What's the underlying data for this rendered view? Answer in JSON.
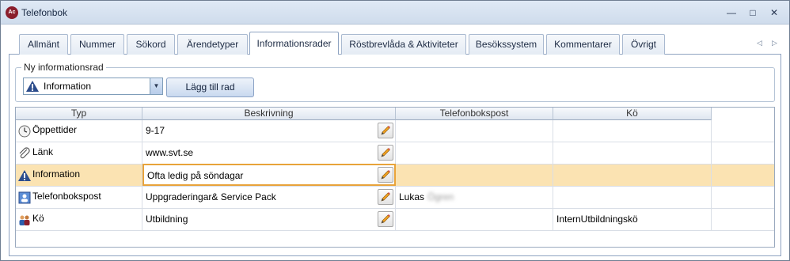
{
  "window": {
    "title": "Telefonbok",
    "app_icon": "Ac",
    "controls": [
      "—",
      "□",
      "✕"
    ]
  },
  "tabs": [
    {
      "label": "Allmänt"
    },
    {
      "label": "Nummer"
    },
    {
      "label": "Sökord"
    },
    {
      "label": "Ärendetyper"
    },
    {
      "label": "Informationsrader",
      "active": true
    },
    {
      "label": "Röstbrevlåda & Aktiviteter"
    },
    {
      "label": "Besökssystem"
    },
    {
      "label": "Kommentarer"
    },
    {
      "label": "Övrigt"
    }
  ],
  "tab_scroll": {
    "left": "◁",
    "right": "▷"
  },
  "new_row": {
    "legend": "Ny informationsrad",
    "type_value": "Information",
    "dropdown_arrow": "▼",
    "add_label": "Lägg till rad"
  },
  "grid": {
    "columns": [
      "Typ",
      "Beskrivning",
      "Telefonbokspost",
      "Kö"
    ],
    "rows": [
      {
        "icon": "clock-icon",
        "type": "Öppettider",
        "description": "9-17",
        "contact": "",
        "queue": ""
      },
      {
        "icon": "paperclip-icon",
        "type": "Länk",
        "description": "www.svt.se",
        "contact": "",
        "queue": ""
      },
      {
        "icon": "info-warning-icon",
        "type": "Information",
        "description": "Ofta ledig på söndagar",
        "contact": "",
        "queue": "",
        "selected": true
      },
      {
        "icon": "contact-card-icon",
        "type": "Telefonbokspost",
        "description": "Uppgraderingar& Service Pack",
        "contact": "Lukas",
        "contact_blurred": "Ögren",
        "queue": ""
      },
      {
        "icon": "people-icon",
        "type": "Kö",
        "description": "Utbildning",
        "contact": "",
        "queue": "InternUtbildningskö"
      }
    ]
  },
  "colors": {
    "selected_row": "#fbe3b2",
    "selected_border": "#e8a33a",
    "accent": "#8ea3c1"
  }
}
